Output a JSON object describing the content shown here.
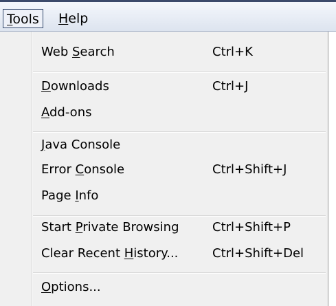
{
  "menubar": {
    "tools": {
      "pre": "",
      "key": "T",
      "post": "ools"
    },
    "help": {
      "pre": "",
      "key": "H",
      "post": "elp"
    }
  },
  "menu": {
    "web_search": {
      "pre": "Web ",
      "key": "S",
      "post": "earch",
      "shortcut": "Ctrl+K"
    },
    "downloads": {
      "pre": "",
      "key": "D",
      "post": "ownloads",
      "shortcut": "Ctrl+J"
    },
    "addons": {
      "pre": "",
      "key": "A",
      "post": "dd-ons",
      "shortcut": ""
    },
    "java_console": {
      "pre": "",
      "key": "J",
      "post": "ava Console",
      "shortcut": ""
    },
    "error_console": {
      "pre": "Error ",
      "key": "C",
      "post": "onsole",
      "shortcut": "Ctrl+Shift+J"
    },
    "page_info": {
      "pre": "Page ",
      "key": "I",
      "post": "nfo",
      "shortcut": ""
    },
    "private_browsing": {
      "pre": "Start ",
      "key": "P",
      "post": "rivate Browsing",
      "shortcut": "Ctrl+Shift+P"
    },
    "clear_history": {
      "pre": "Clear Recent ",
      "key": "H",
      "post": "istory...",
      "shortcut": "Ctrl+Shift+Del"
    },
    "options": {
      "pre": "",
      "key": "O",
      "post": "ptions...",
      "shortcut": ""
    }
  }
}
